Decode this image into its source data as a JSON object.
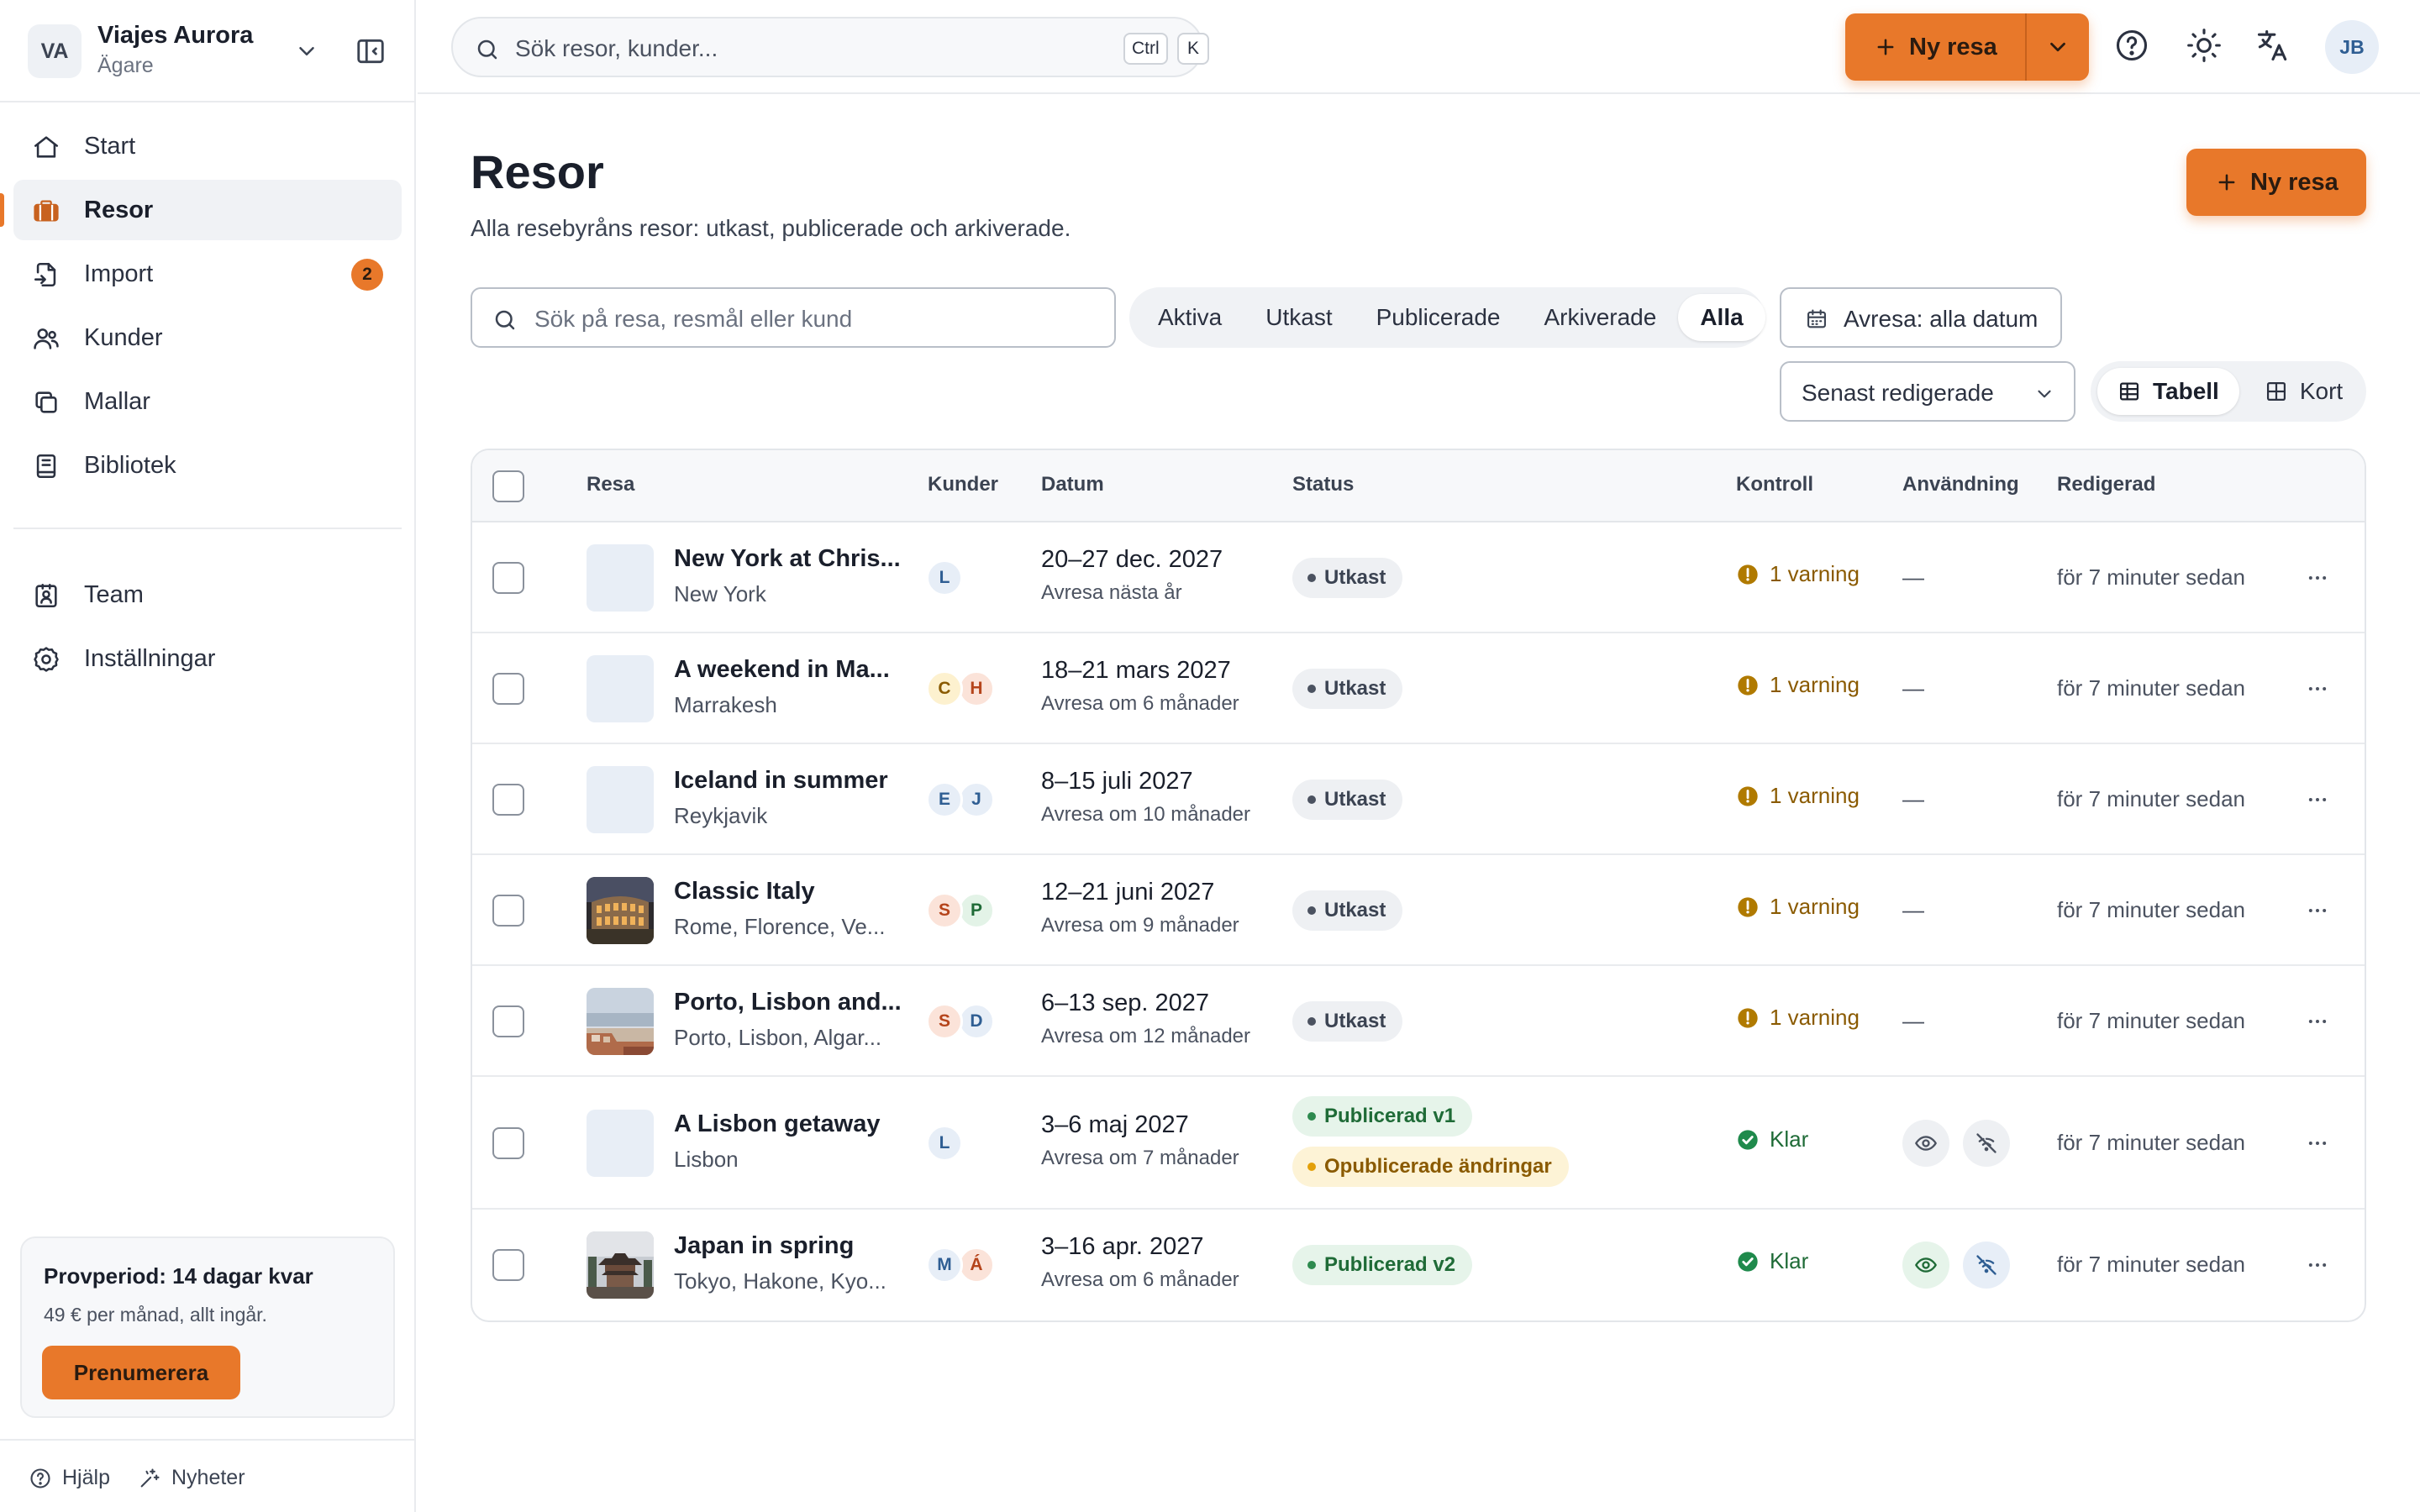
{
  "org": {
    "initials": "VA",
    "name": "Viajes Aurora",
    "role": "Ägare"
  },
  "nav": {
    "items": [
      {
        "label": "Start"
      },
      {
        "label": "Resor"
      },
      {
        "label": "Import",
        "badge": "2"
      },
      {
        "label": "Kunder"
      },
      {
        "label": "Mallar"
      },
      {
        "label": "Bibliotek"
      }
    ],
    "secondary": [
      {
        "label": "Team"
      },
      {
        "label": "Inställningar"
      }
    ]
  },
  "trial": {
    "title": "Provperiod: 14 dagar kvar",
    "subtitle": "49 € per månad, allt ingår.",
    "button": "Prenumerera"
  },
  "footer": {
    "help": "Hjälp",
    "news": "Nyheter"
  },
  "topbar": {
    "search_placeholder": "Sök resor, kunder...",
    "kbd_ctrl": "Ctrl",
    "kbd_k": "K",
    "new_trip": "Ny resa",
    "user_initials": "JB"
  },
  "page": {
    "title": "Resor",
    "subtitle": "Alla resebyråns resor: utkast, publicerade och arkiverade.",
    "cta": "Ny resa"
  },
  "filters": {
    "search_placeholder": "Sök på resa, resmål eller kund",
    "tabs": [
      "Aktiva",
      "Utkast",
      "Publicerade",
      "Arkiverade",
      "Alla"
    ],
    "active_tab": "Alla",
    "date_filter": "Avresa: alla datum",
    "sort": "Senast redigerade",
    "view_table": "Tabell",
    "view_cards": "Kort",
    "active_view": "Tabell"
  },
  "table": {
    "headers": {
      "trip": "Resa",
      "customers": "Kunder",
      "date": "Datum",
      "status": "Status",
      "control": "Kontroll",
      "usage": "Användning",
      "edited": "Redigerad"
    },
    "rows": [
      {
        "name": "New York at Chris...",
        "dest": "New York",
        "customers": [
          "L"
        ],
        "date": "20–27 dec. 2027",
        "rel": "Avresa nästa år",
        "status": [
          {
            "kind": "draft",
            "label": "Utkast"
          }
        ],
        "control": {
          "kind": "warn",
          "label": "1 varning"
        },
        "usage": "—",
        "edited": "för 7 minuter sedan",
        "thumb": "none"
      },
      {
        "name": "A weekend in Ma...",
        "dest": "Marrakesh",
        "customers": [
          "C",
          "H"
        ],
        "date": "18–21 mars 2027",
        "rel": "Avresa om 6 månader",
        "status": [
          {
            "kind": "draft",
            "label": "Utkast"
          }
        ],
        "control": {
          "kind": "warn",
          "label": "1 varning"
        },
        "usage": "—",
        "edited": "för 7 minuter sedan",
        "thumb": "none"
      },
      {
        "name": "Iceland in summer",
        "dest": "Reykjavik",
        "customers": [
          "E",
          "J"
        ],
        "date": "8–15 juli 2027",
        "rel": "Avresa om 10 månader",
        "status": [
          {
            "kind": "draft",
            "label": "Utkast"
          }
        ],
        "control": {
          "kind": "warn",
          "label": "1 varning"
        },
        "usage": "—",
        "edited": "för 7 minuter sedan",
        "thumb": "none"
      },
      {
        "name": "Classic Italy",
        "dest": "Rome, Florence, Ve...",
        "customers": [
          "S",
          "P"
        ],
        "date": "12–21 juni 2027",
        "rel": "Avresa om 9 månader",
        "status": [
          {
            "kind": "draft",
            "label": "Utkast"
          }
        ],
        "control": {
          "kind": "warn",
          "label": "1 varning"
        },
        "usage": "—",
        "edited": "för 7 minuter sedan",
        "thumb": "colosseum"
      },
      {
        "name": "Porto, Lisbon and...",
        "dest": "Porto, Lisbon, Algar...",
        "customers": [
          "S",
          "D"
        ],
        "date": "6–13 sep. 2027",
        "rel": "Avresa om 12 månader",
        "status": [
          {
            "kind": "draft",
            "label": "Utkast"
          }
        ],
        "control": {
          "kind": "warn",
          "label": "1 varning"
        },
        "usage": "—",
        "edited": "för 7 minuter sedan",
        "thumb": "coast"
      },
      {
        "name": "A Lisbon getaway",
        "dest": "Lisbon",
        "customers": [
          "L"
        ],
        "date": "3–6 maj 2027",
        "rel": "Avresa om 7 månader",
        "status": [
          {
            "kind": "pub",
            "label": "Publicerad v1"
          },
          {
            "kind": "unpub",
            "label": "Opublicerade ändringar"
          }
        ],
        "control": {
          "kind": "ok",
          "label": "Klar"
        },
        "usage": "icons-grey",
        "edited": "för 7 minuter sedan",
        "thumb": "none"
      },
      {
        "name": "Japan in spring",
        "dest": "Tokyo, Hakone, Kyo...",
        "customers": [
          "M",
          "Á"
        ],
        "date": "3–16 apr. 2027",
        "rel": "Avresa om 6 månader",
        "status": [
          {
            "kind": "pub",
            "label": "Publicerad v2"
          }
        ],
        "control": {
          "kind": "ok",
          "label": "Klar"
        },
        "usage": "icons-color",
        "edited": "för 7 minuter sedan",
        "thumb": "temple"
      }
    ]
  },
  "colors": {
    "accent": "#e8782a",
    "warn": "#b07a00",
    "ok": "#1f8a4c",
    "avatar_palette": {
      "L": [
        "#e7eef7",
        "#2f5e93"
      ],
      "C": [
        "#fdf1cf",
        "#8a5a00"
      ],
      "H": [
        "#fbe3d9",
        "#b5441b"
      ],
      "E": [
        "#e7eef7",
        "#2f5e93"
      ],
      "J": [
        "#e7eef7",
        "#2f5e93"
      ],
      "S": [
        "#fbe3d9",
        "#b5441b"
      ],
      "P": [
        "#e3f3e7",
        "#1f6b37"
      ],
      "D": [
        "#e7eef7",
        "#2f5e93"
      ],
      "M": [
        "#e7eef7",
        "#2f5e93"
      ],
      "Á": [
        "#fbe3d9",
        "#b5441b"
      ]
    }
  }
}
